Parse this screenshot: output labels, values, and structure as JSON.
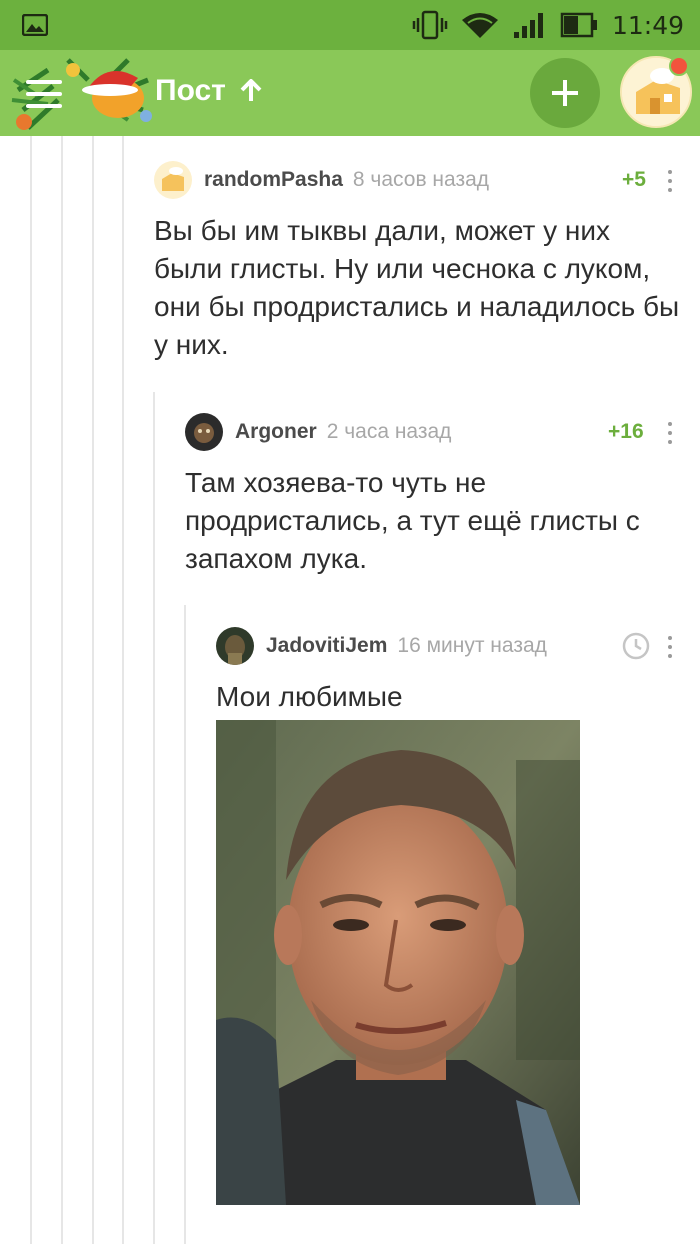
{
  "status_bar": {
    "time": "11:49",
    "icons": [
      "gallery-icon",
      "vibrate-icon",
      "wifi-icon",
      "signal-icon",
      "battery-icon"
    ]
  },
  "app_bar": {
    "title": "Пост",
    "menu_icon": "hamburger-icon",
    "scroll_up_icon": "arrow-up-icon",
    "add_icon": "plus-icon",
    "colors": {
      "bar": "#8ac858",
      "status": "#6cb13e",
      "accent": "#6cae3d"
    }
  },
  "comments": [
    {
      "user": "randomPasha",
      "time": "8 часов назад",
      "rating": "+5",
      "text": "Вы бы им тыквы дали, может у них были глисты. Ну или чеснока с луком, они бы продристались и наладилось бы у них."
    },
    {
      "user": "Argoner",
      "time": "2 часа назад",
      "rating": "+16",
      "text": "Там хозяева-то чуть не продристались, а тут ещё глисты с запахом лука."
    },
    {
      "user": "JadovitiJem",
      "time": "16 минут назад",
      "rating_icon": "clock-icon",
      "text": "Мои любимые",
      "image": "portrait-photo"
    }
  ]
}
